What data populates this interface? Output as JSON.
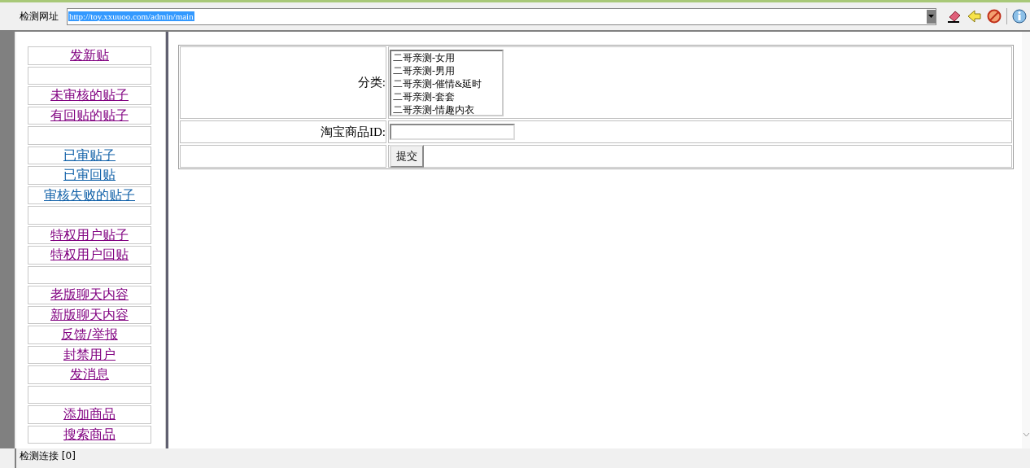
{
  "toolbar": {
    "label": "检测网址",
    "url": {
      "value": "http://toy.xxuuoo.com/admin/main",
      "selected": true
    }
  },
  "sidebar": {
    "items": [
      {
        "kind": "link",
        "label": "发新贴",
        "visited": true
      },
      {
        "kind": "blank"
      },
      {
        "kind": "link",
        "label": "未审核的贴子",
        "visited": true
      },
      {
        "kind": "link",
        "label": "有回贴的贴子",
        "visited": true
      },
      {
        "kind": "blank"
      },
      {
        "kind": "link",
        "label": "已审贴子",
        "visited": false
      },
      {
        "kind": "link",
        "label": "已审回贴",
        "visited": false
      },
      {
        "kind": "link",
        "label": "审核失败的贴子",
        "visited": false
      },
      {
        "kind": "blank"
      },
      {
        "kind": "link",
        "label": "特权用户贴子",
        "visited": true
      },
      {
        "kind": "link",
        "label": "特权用户回贴",
        "visited": true
      },
      {
        "kind": "blank"
      },
      {
        "kind": "link",
        "label": "老版聊天内容",
        "visited": true
      },
      {
        "kind": "link",
        "label": "新版聊天内容",
        "visited": true
      },
      {
        "kind": "link",
        "label": "反馈/举报",
        "visited": true
      },
      {
        "kind": "link",
        "label": "封禁用户",
        "visited": true
      },
      {
        "kind": "link",
        "label": "发消息",
        "visited": true
      },
      {
        "kind": "blank"
      },
      {
        "kind": "link",
        "label": "添加商品",
        "visited": true
      },
      {
        "kind": "link",
        "label": "搜索商品",
        "visited": true
      }
    ]
  },
  "form": {
    "category": {
      "label": "分类:",
      "options": [
        "二哥亲测-女用",
        "二哥亲测-男用",
        "二哥亲测-催情&延时",
        "二哥亲测-套套",
        "二哥亲测-情趣内衣"
      ]
    },
    "item_id": {
      "label": "淘宝商品ID:"
    },
    "submit": "提交"
  },
  "status_bar": "检测连接 [0]"
}
